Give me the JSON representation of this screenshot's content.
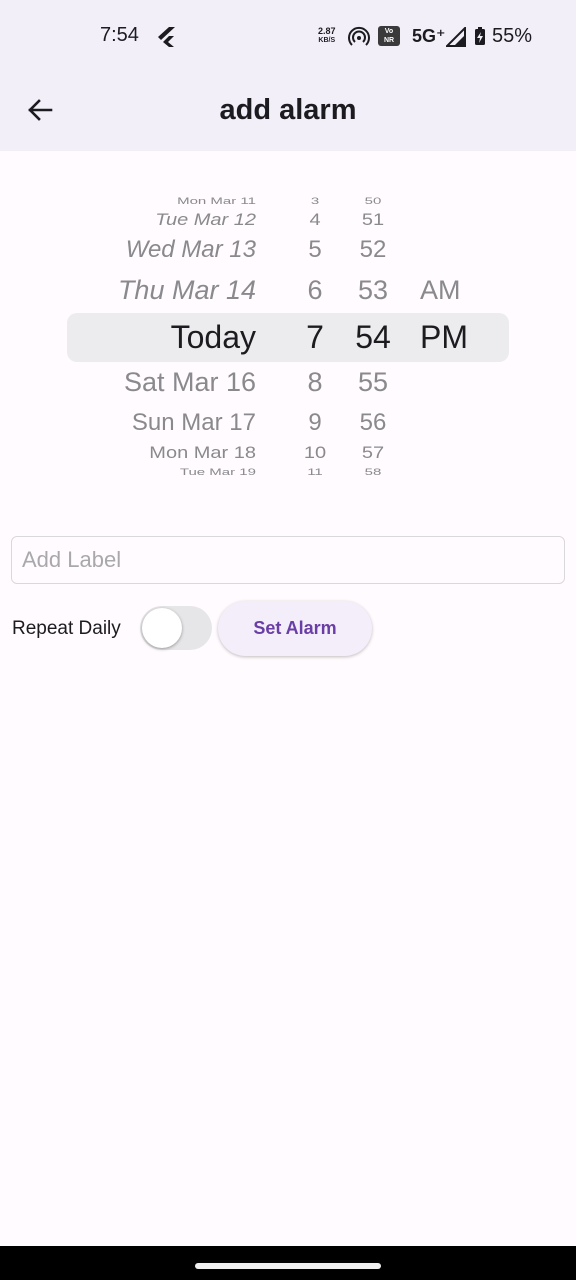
{
  "status_bar": {
    "time": "7:54",
    "speed_value": "2.87",
    "speed_unit": "KB/S",
    "vonr_line1": "Vo",
    "vonr_line2": "NR",
    "network": "5G⁺",
    "battery": "55%",
    "icons": [
      "flutter-icon",
      "hotspot-icon",
      "vonr-icon",
      "signal-icon",
      "battery-charging-icon"
    ]
  },
  "app_bar": {
    "title": "add alarm",
    "back_icon": "arrow-left-icon"
  },
  "picker": {
    "dates": [
      "Mon Mar 11",
      "Tue Mar 12",
      "Wed Mar 13",
      "Thu Mar 14",
      "Today",
      "Sat Mar 16",
      "Sun Mar 17",
      "Mon Mar 18",
      "Tue Mar 19"
    ],
    "hours": [
      "3",
      "4",
      "5",
      "6",
      "7",
      "8",
      "9",
      "10",
      "11"
    ],
    "minutes": [
      "50",
      "51",
      "52",
      "53",
      "54",
      "55",
      "56",
      "57",
      "58"
    ],
    "ampm": [
      "AM",
      "PM"
    ],
    "selected": {
      "date": "Today",
      "hour": "7",
      "minute": "54",
      "ampm": "PM"
    }
  },
  "form": {
    "label_placeholder": "Add Label",
    "label_value": "",
    "repeat_label": "Repeat Daily",
    "repeat_on": false,
    "set_alarm_label": "Set Alarm"
  },
  "colors": {
    "app_bar_bg": "#f2eff9",
    "background": "#fffbfe",
    "accent": "#6a3fa5",
    "picker_highlight": "#ececee"
  }
}
